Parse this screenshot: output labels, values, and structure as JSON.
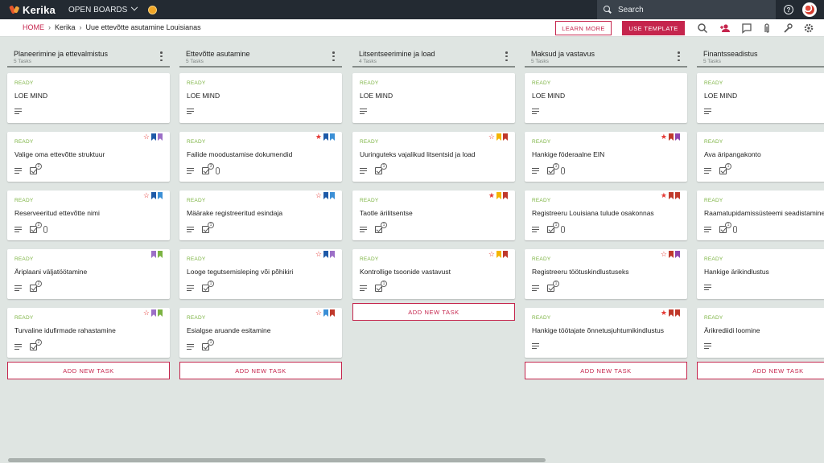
{
  "app": {
    "name": "Kerika",
    "open_boards_label": "OPEN BOARDS"
  },
  "search": {
    "placeholder": "Search"
  },
  "breadcrumb": {
    "home": "HOME",
    "account": "Kerika",
    "board": "Uue ettevõtte asutamine Louisianas"
  },
  "toolbar": {
    "learn_more": "LEARN MORE",
    "use_template": "USE TEMPLATE"
  },
  "colors": {
    "accent": "#c5254d",
    "status_ready": "#7cb342",
    "topbar": "#232a32",
    "background": "#dfe5e2"
  },
  "add_task_label": "ADD NEW TASK",
  "columns": [
    {
      "title": "Planeerimine ja ettevalmistus",
      "count": "5 Tasks",
      "cards": [
        {
          "status": "READY",
          "title": "LOE MIND",
          "checklist": null,
          "attachment": false,
          "star": null,
          "bookmarks": []
        },
        {
          "status": "READY",
          "title": "Valige oma ettevõtte struktuur",
          "checklist": "2",
          "attachment": false,
          "star": "outline",
          "bookmarks": [
            "#1e5aa8",
            "#9c6fc7"
          ]
        },
        {
          "status": "READY",
          "title": "Reserveeritud ettevõtte nimi",
          "checklist": "2",
          "attachment": true,
          "star": "outline",
          "bookmarks": [
            "#1e5aa8",
            "#3b8fd6"
          ]
        },
        {
          "status": "READY",
          "title": "Äriplaani väljatöötamine",
          "checklist": "2",
          "attachment": false,
          "star": null,
          "bookmarks": [
            "#9c6fc7",
            "#7cb342"
          ]
        },
        {
          "status": "READY",
          "title": "Turvaline idufirmade rahastamine",
          "checklist": "2",
          "attachment": false,
          "star": "outline",
          "bookmarks": [
            "#9c6fc7",
            "#7cb342"
          ]
        }
      ]
    },
    {
      "title": "Ettevõtte asutamine",
      "count": "5 Tasks",
      "cards": [
        {
          "status": "READY",
          "title": "LOE MIND",
          "checklist": null,
          "attachment": false,
          "star": null,
          "bookmarks": []
        },
        {
          "status": "READY",
          "title": "Failide moodustamise dokumendid",
          "checklist": "3",
          "attachment": true,
          "star": "filled",
          "bookmarks": [
            "#1e5aa8",
            "#3b8fd6"
          ]
        },
        {
          "status": "READY",
          "title": "Määrake registreeritud esindaja",
          "checklist": "1",
          "attachment": false,
          "star": "outline",
          "bookmarks": [
            "#1e5aa8",
            "#3b8fd6"
          ]
        },
        {
          "status": "READY",
          "title": "Looge tegutsemisleping või põhikiri",
          "checklist": "1",
          "attachment": false,
          "star": "outline",
          "bookmarks": [
            "#1e5aa8",
            "#9c6fc7"
          ]
        },
        {
          "status": "READY",
          "title": "Esialgse aruande esitamine",
          "checklist": "1",
          "attachment": false,
          "star": "outline",
          "bookmarks": [
            "#3b8fd6",
            "#c0392b"
          ]
        }
      ]
    },
    {
      "title": "Litsentseerimine ja load",
      "count": "4 Tasks",
      "cards": [
        {
          "status": "READY",
          "title": "LOE MIND",
          "checklist": null,
          "attachment": false,
          "star": null,
          "bookmarks": []
        },
        {
          "status": "READY",
          "title": "Uuringuteks vajalikud litsentsid ja load",
          "checklist": "1",
          "attachment": false,
          "star": "outline",
          "bookmarks": [
            "#f4b400",
            "#c0392b"
          ]
        },
        {
          "status": "READY",
          "title": "Taotle ärilitsentse",
          "checklist": "1",
          "attachment": false,
          "star": "filled",
          "bookmarks": [
            "#f4b400",
            "#c0392b"
          ]
        },
        {
          "status": "READY",
          "title": "Kontrollige tsoonide vastavust",
          "checklist": "1",
          "attachment": false,
          "star": "outline",
          "bookmarks": [
            "#f4b400",
            "#c0392b"
          ]
        }
      ]
    },
    {
      "title": "Maksud ja vastavus",
      "count": "5 Tasks",
      "cards": [
        {
          "status": "READY",
          "title": "LOE MIND",
          "checklist": null,
          "attachment": false,
          "star": null,
          "bookmarks": []
        },
        {
          "status": "READY",
          "title": "Hankige föderaalne EIN",
          "checklist": "1",
          "attachment": true,
          "star": "filled",
          "bookmarks": [
            "#c0392b",
            "#8e44ad"
          ]
        },
        {
          "status": "READY",
          "title": "Registreeru Louisiana tulude osakonnas",
          "checklist": "1",
          "attachment": true,
          "star": "filled",
          "bookmarks": [
            "#c0392b",
            "#c0392b"
          ]
        },
        {
          "status": "READY",
          "title": "Registreeru töötuskindlustuseks",
          "checklist": "1",
          "attachment": false,
          "star": "outline",
          "bookmarks": [
            "#c0392b",
            "#8e44ad"
          ]
        },
        {
          "status": "READY",
          "title": "Hankige töötajate õnnetusjuhtumikindlustus",
          "checklist": null,
          "attachment": false,
          "star": "filled",
          "bookmarks": [
            "#c0392b",
            "#c0392b"
          ]
        }
      ]
    },
    {
      "title": "Finantsseadistus",
      "count": "5 Tasks",
      "cards": [
        {
          "status": "READY",
          "title": "LOE MIND",
          "checklist": null,
          "attachment": false,
          "star": null,
          "bookmarks": []
        },
        {
          "status": "READY",
          "title": "Ava äripangakonto",
          "checklist": "1",
          "attachment": false,
          "star": null,
          "bookmarks": []
        },
        {
          "status": "READY",
          "title": "Raamatupidamissüsteemi seadistamine",
          "checklist": "1",
          "attachment": true,
          "star": null,
          "bookmarks": []
        },
        {
          "status": "READY",
          "title": "Hankige ärikindlustus",
          "checklist": null,
          "attachment": false,
          "star": null,
          "bookmarks": []
        },
        {
          "status": "READY",
          "title": "Ärikrediidi loomine",
          "checklist": null,
          "attachment": false,
          "star": null,
          "bookmarks": []
        }
      ]
    }
  ]
}
